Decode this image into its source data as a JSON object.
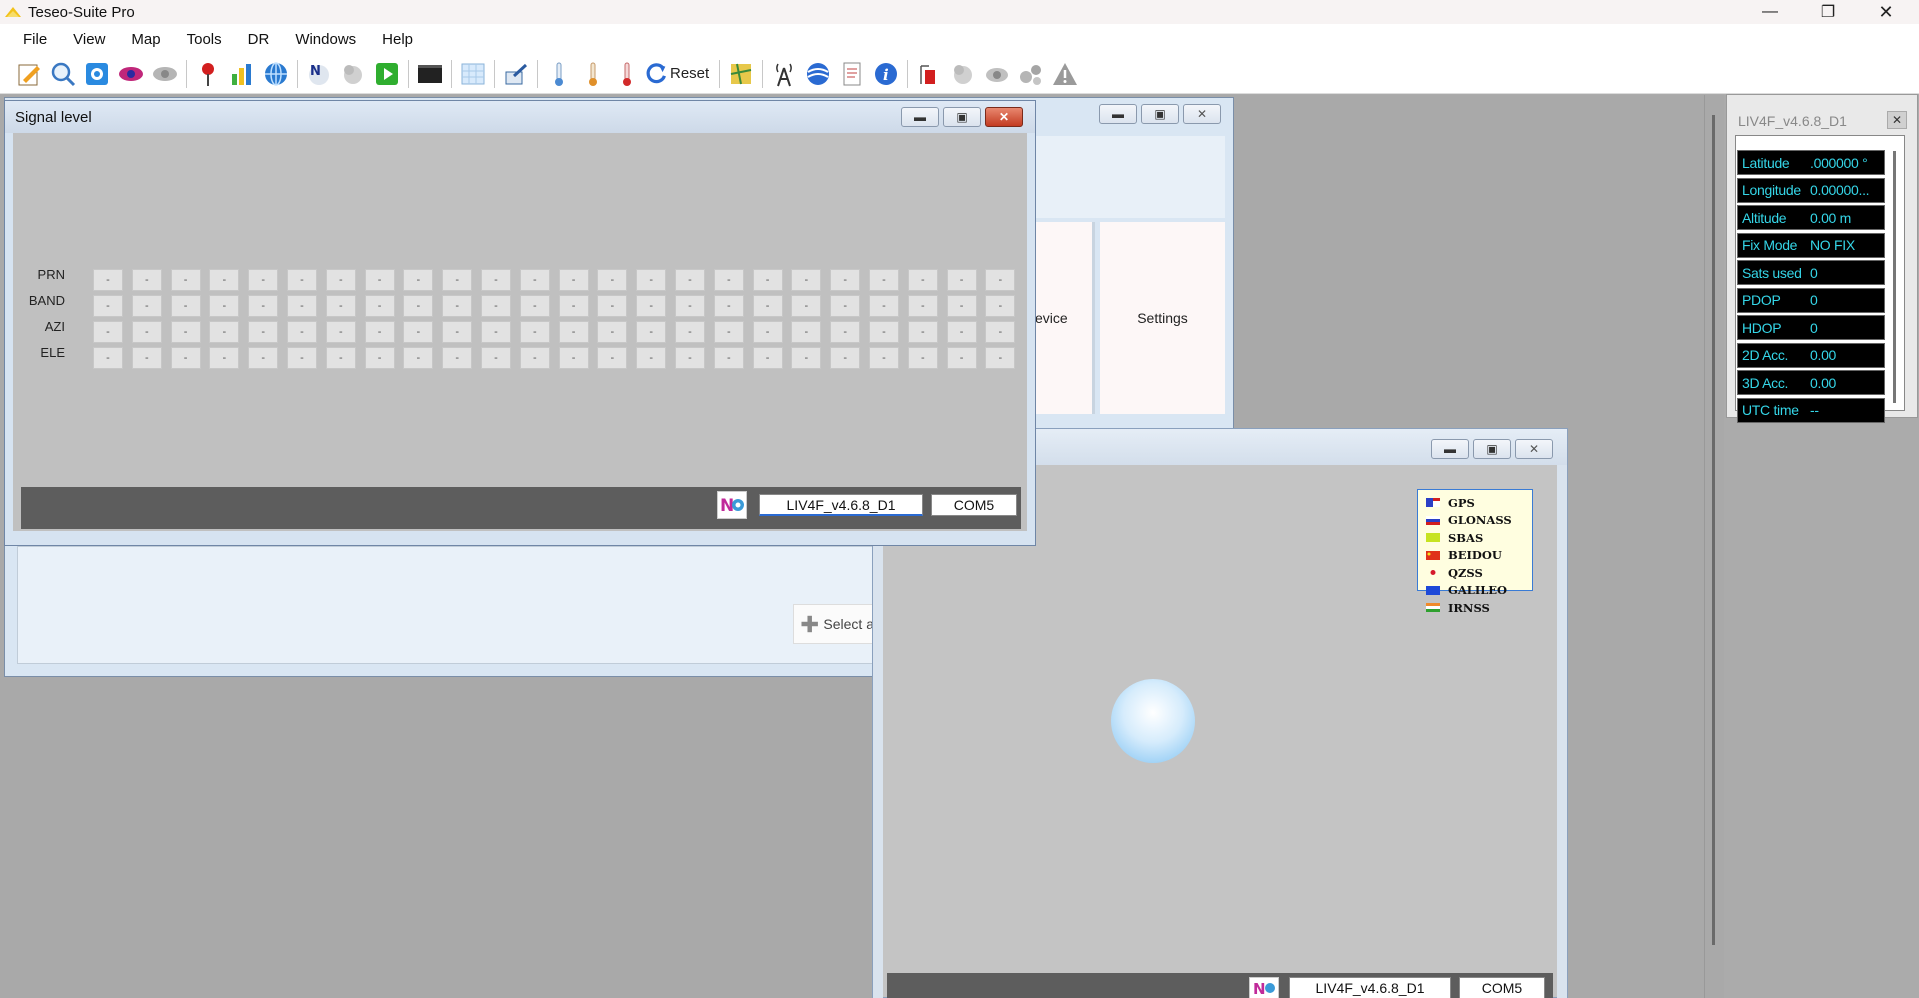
{
  "app": {
    "title": "Teseo-Suite Pro"
  },
  "menu": [
    "File",
    "View",
    "Map",
    "Tools",
    "DR",
    "Windows",
    "Help"
  ],
  "toolbar": {
    "reset_label": "Reset"
  },
  "signal_window": {
    "title": "Signal level",
    "row_labels": [
      "PRN",
      "BAND",
      "AZI",
      "ELE"
    ],
    "cell_value": "-",
    "columns": 24,
    "device": "LIV4F_v4.6.8_D1",
    "port": "COM5"
  },
  "back_window": {
    "device_text": "evice",
    "settings_text": "Settings",
    "select_text": "Select a"
  },
  "sky_window": {
    "legend": [
      {
        "name": "GPS",
        "color": "#2b3fc6"
      },
      {
        "name": "GLONASS",
        "color": "#2b3fc6"
      },
      {
        "name": "SBAS",
        "color": "#c7e321"
      },
      {
        "name": "BEIDOU",
        "color": "#e0321a"
      },
      {
        "name": "QZSS",
        "color": "#d51a2b"
      },
      {
        "name": "GALILEO",
        "color": "#1e49d8"
      },
      {
        "name": "IRNSS",
        "color": "#f08a2a"
      }
    ],
    "device": "LIV4F_v4.6.8_D1",
    "port": "COM5"
  },
  "info_panel": {
    "title": "LIV4F_v4.6.8_D1",
    "rows": [
      {
        "k": "Latitude",
        "v": ".000000 °"
      },
      {
        "k": "Longitude",
        "v": "0.00000..."
      },
      {
        "k": "Altitude",
        "v": "0.00 m"
      },
      {
        "k": "Fix Mode",
        "v": "NO FIX"
      },
      {
        "k": "Sats used",
        "v": "0"
      },
      {
        "k": "PDOP",
        "v": "0"
      },
      {
        "k": "HDOP",
        "v": "0"
      },
      {
        "k": "2D Acc.",
        "v": "0.00"
      },
      {
        "k": "3D Acc.",
        "v": "0.00"
      },
      {
        "k": "UTC time",
        "v": "--"
      }
    ]
  }
}
